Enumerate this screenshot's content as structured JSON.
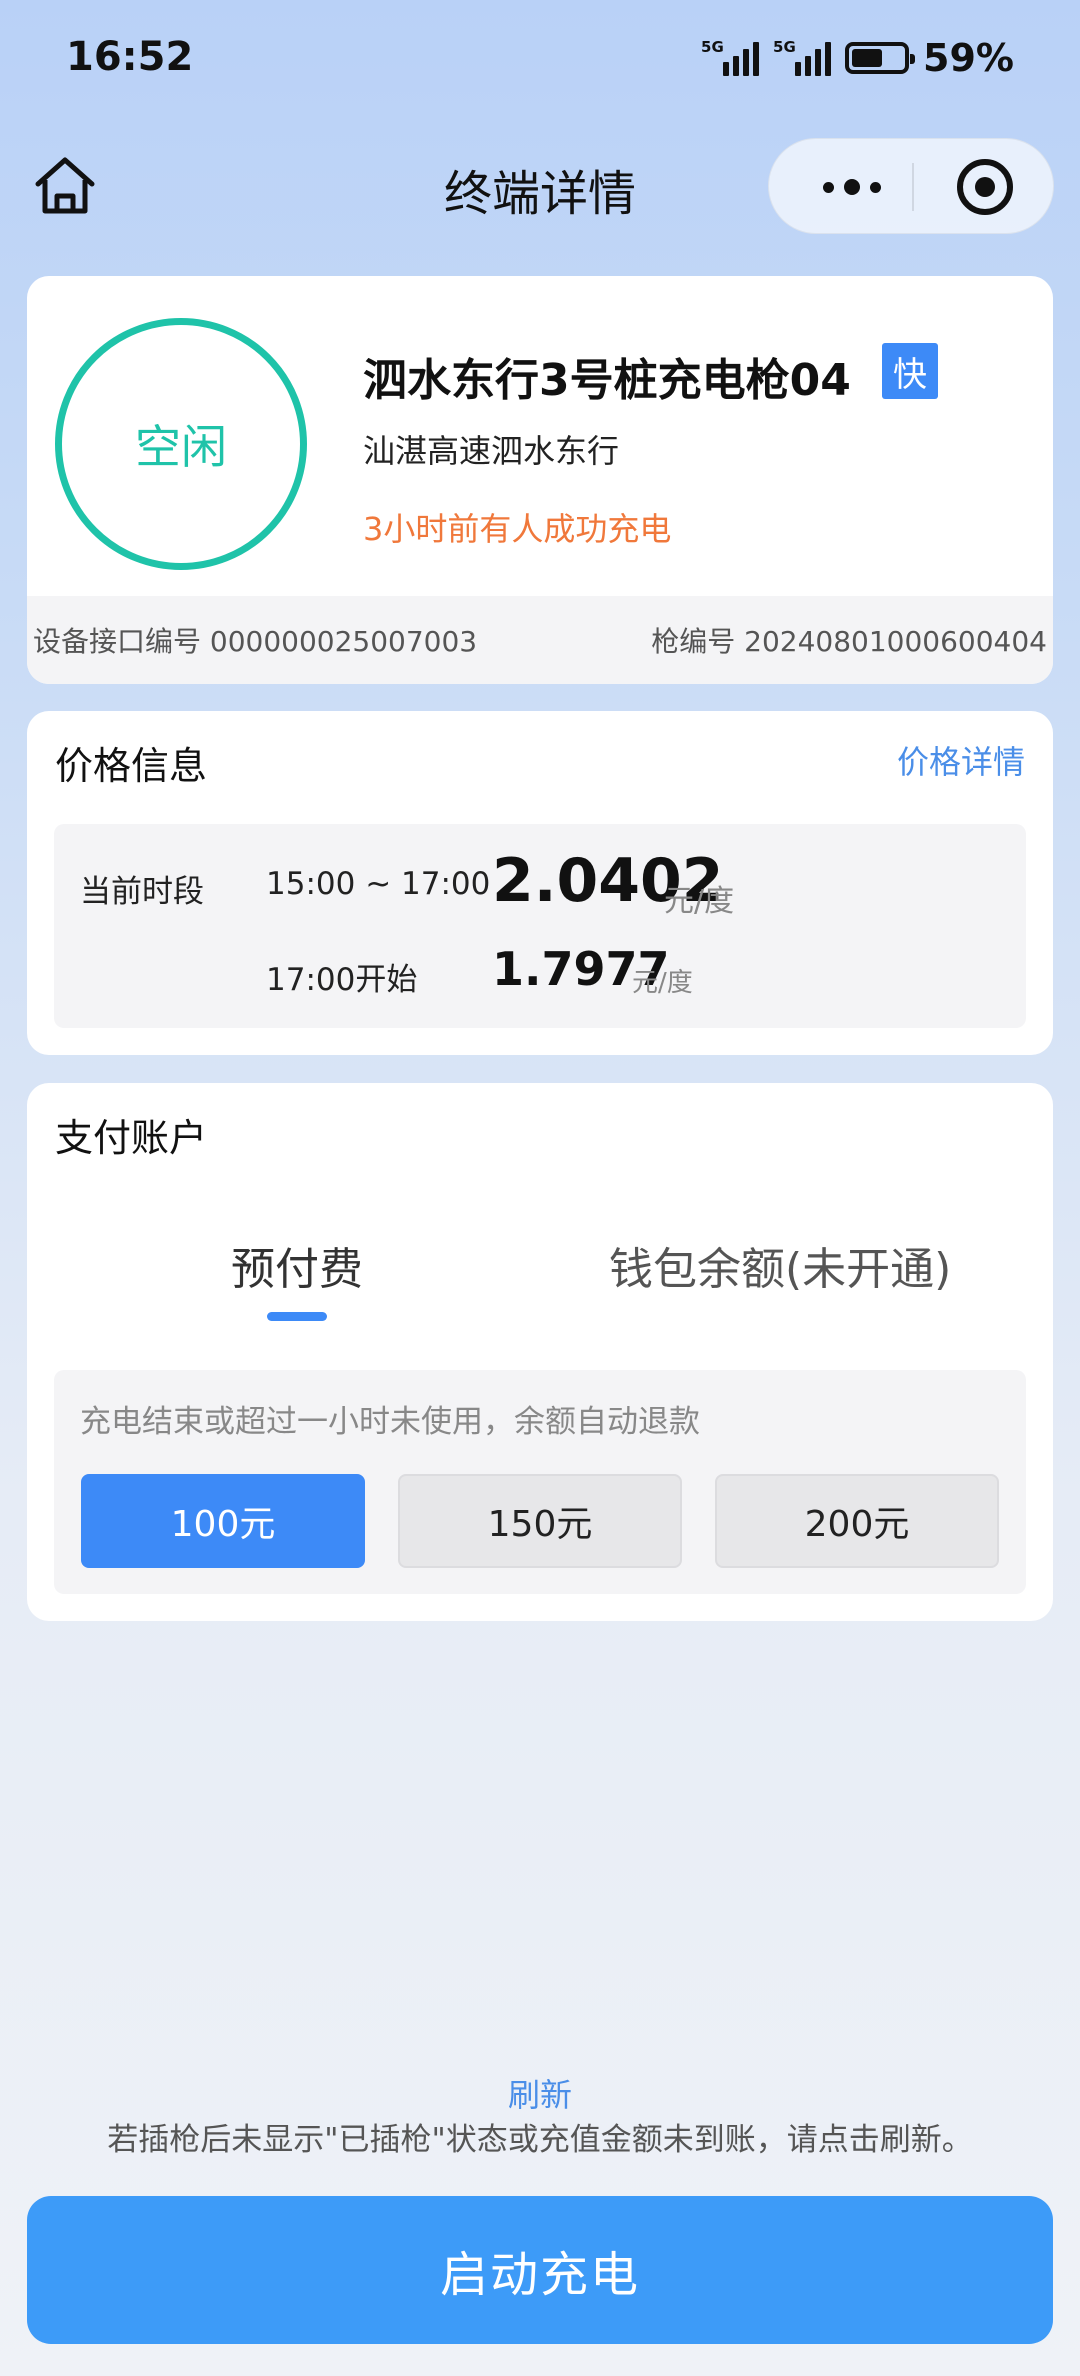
{
  "status_bar": {
    "time": "16:52",
    "network1": "5G",
    "network2": "5G",
    "battery_level": 0.59,
    "battery_pct": "59%"
  },
  "nav": {
    "title": "终端详情",
    "home_icon": "home-icon",
    "more_icon": "more-dots-icon",
    "close_icon": "target-close-icon"
  },
  "terminal": {
    "status": "空闲",
    "name": "泗水东行3号桩充电枪04",
    "type_badge": "快",
    "location": "汕湛高速泗水东行",
    "recent": "3小时前有人成功充电",
    "interface_no": "设备接口编号 000000025007003",
    "gun_no": "枪编号 20240801000600404",
    "colors": {
      "status": "#1fc3a9",
      "badge": "#3d8af7",
      "recent": "#f0783b"
    }
  },
  "price": {
    "title": "价格信息",
    "detail_link": "价格详情",
    "current_label": "当前时段",
    "current_period": "15:00 ~ 17:00",
    "current_price": "2.0402",
    "current_unit": "元/度",
    "next_period": "17:00开始",
    "next_price": "1.7977",
    "next_unit": "元/度"
  },
  "payment": {
    "title": "支付账户",
    "tabs": [
      {
        "label": "预付费",
        "active": true
      },
      {
        "label": "钱包余额(未开通)",
        "active": false
      }
    ],
    "note": "充电结束或超过一小时未使用，余额自动退款",
    "amounts": [
      {
        "label": "100元",
        "selected": true
      },
      {
        "label": "150元",
        "selected": false
      },
      {
        "label": "200元",
        "selected": false
      }
    ]
  },
  "footer": {
    "refresh": "刷新",
    "hint": "若插枪后未显示\"已插枪\"状态或充值金额未到账，请点击刷新。",
    "start_button": "启动充电"
  }
}
